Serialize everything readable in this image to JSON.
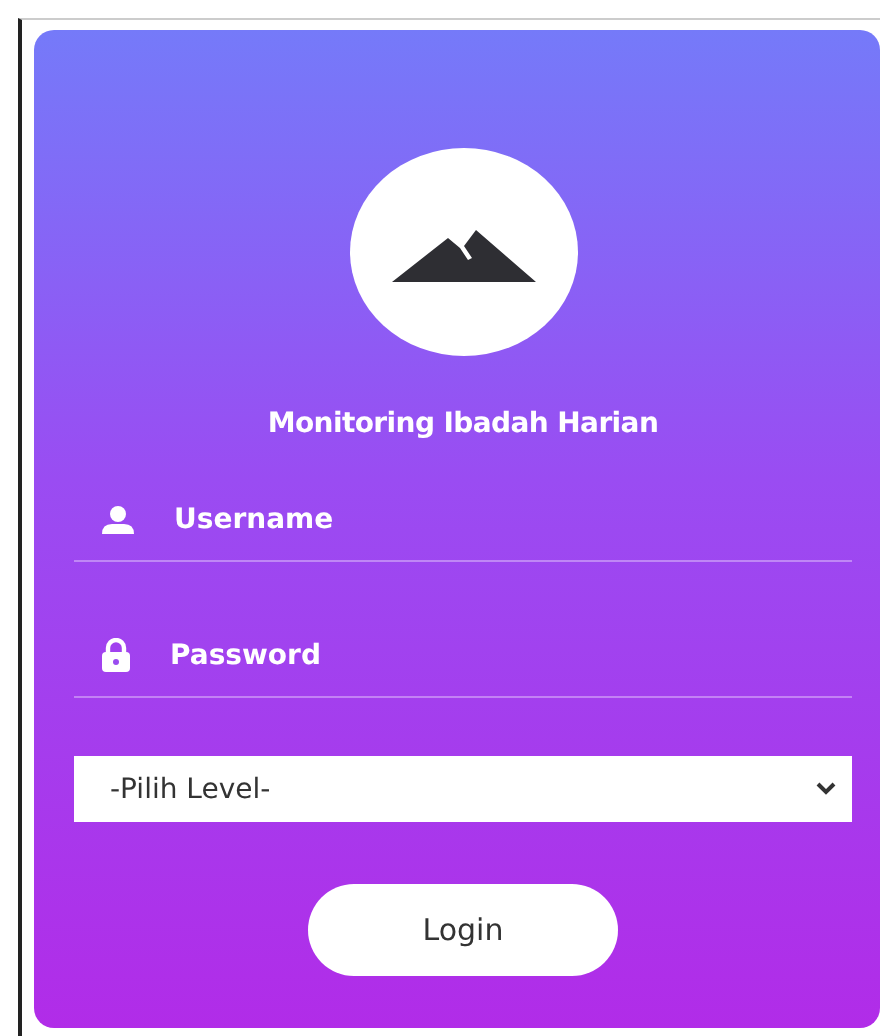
{
  "title": "Monitoring Ibadah Harian",
  "fields": [
    {
      "kind": "user",
      "placeholder": "Username"
    },
    {
      "kind": "lock",
      "placeholder": "Password"
    }
  ],
  "level_select": {
    "value": "-Pilih Level-"
  },
  "button": "Login"
}
